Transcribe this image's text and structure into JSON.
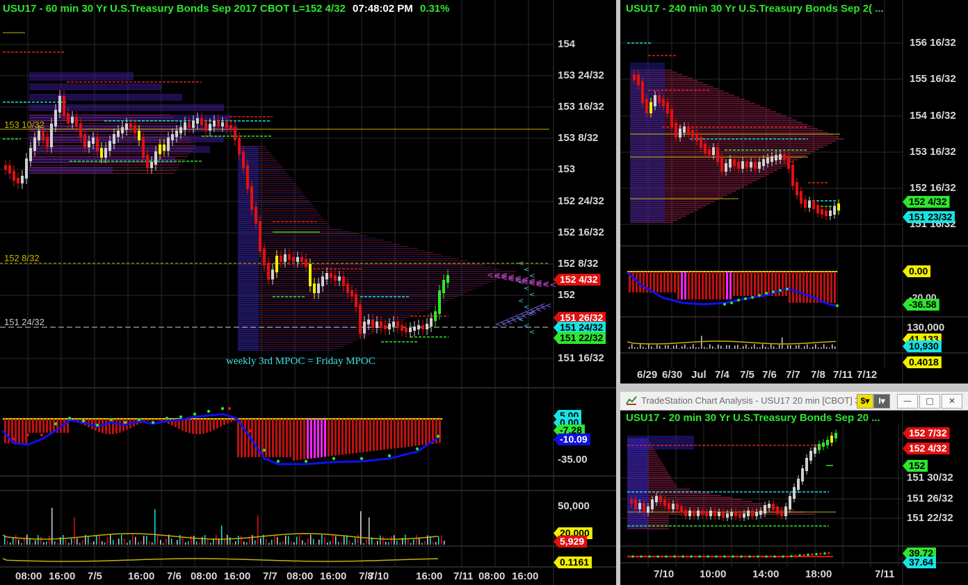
{
  "main_chart": {
    "title_parts": {
      "instrument": "USU17 - 60 min  30 Yr U.S.Treasury Bonds Sep 2017  CBOT  L=152 4/32",
      "time": "07:48:02 PM",
      "change": "0.31%"
    },
    "price_axis": [
      "154",
      "153 24/32",
      "153 16/32",
      "153 8/32",
      "153",
      "152 24/32",
      "152 16/32",
      "152 8/32",
      "152",
      "151 16/32"
    ],
    "price_tags": [
      {
        "text": "152 4/32",
        "bg": "#e01010",
        "fg": "#ffffff"
      },
      {
        "text": "151 26/32",
        "bg": "#e01010",
        "fg": "#ffffff"
      },
      {
        "text": "151 24/32",
        "bg": "#17e3e3",
        "fg": "#000000"
      },
      {
        "text": "151 22/32",
        "bg": "#2ee62e",
        "fg": "#000000"
      }
    ],
    "levels": [
      "153 10/32",
      "152 8/32",
      "151 24/32"
    ],
    "annotation": "weekly 3rd MPOC = Friday MPOC",
    "indicator_axis": [
      "-35.00"
    ],
    "indicator_tags": [
      {
        "text": "5.00",
        "bg": "#17e3e3",
        "fg": "#000000"
      },
      {
        "text": "0.00",
        "bg": "#17e3e3",
        "fg": "#000000"
      },
      {
        "text": "-7.28",
        "bg": "#2ee62e",
        "fg": "#000000"
      },
      {
        "text": "-10.09",
        "bg": "#1010e0",
        "fg": "#ffffff"
      }
    ],
    "volume_axis": [
      "50,000"
    ],
    "volume_tags": [
      {
        "text": "20,000",
        "bg": "#f0f000",
        "fg": "#000000"
      },
      {
        "text": "5,929",
        "bg": "#e01010",
        "fg": "#ffffff"
      }
    ],
    "osc_tag": {
      "text": "0.1161",
      "bg": "#f0f000",
      "fg": "#000000"
    },
    "x_axis": [
      "08:00",
      "16:00",
      "7/5",
      "16:00",
      "7/6",
      "08:00",
      "16:00",
      "7/7",
      "08:00",
      "16:00",
      "7/8",
      "7/10",
      "16:00",
      "7/11",
      "08:00",
      "16:00"
    ]
  },
  "chart_240": {
    "title": "USU17 - 240 min  30 Yr U.S.Treasury Bonds Sep 2( ...",
    "price_axis": [
      "156 16/32",
      "155 16/32",
      "154 16/32",
      "153 16/32",
      "152 16/32",
      "151 16/32"
    ],
    "price_tags": [
      {
        "text": "152 4/32",
        "bg": "#2ee62e",
        "fg": "#000000"
      },
      {
        "text": "151 23/32",
        "bg": "#17e3e3",
        "fg": "#000000"
      }
    ],
    "indicator_tags": [
      {
        "text": "0.00",
        "bg": "#f0f000",
        "fg": "#000000"
      },
      {
        "text": "-20.00",
        "bg": "#000000",
        "fg": "#d8d8d8"
      },
      {
        "text": "-36.58",
        "bg": "#2ee62e",
        "fg": "#000000"
      }
    ],
    "volume_axis": [
      "130,000"
    ],
    "volume_tags": [
      {
        "text": "41,133",
        "bg": "#f0f000",
        "fg": "#000000"
      },
      {
        "text": "10,930",
        "bg": "#17e3e3",
        "fg": "#000000"
      },
      {
        "text": "0.4018",
        "bg": "#f0f000",
        "fg": "#000000"
      }
    ],
    "x_axis": [
      "6/29",
      "6/30",
      "Jul",
      "7/4",
      "7/5",
      "7/6",
      "7/7",
      "7/8",
      "7/11",
      "7/12"
    ]
  },
  "chart_20": {
    "window_title": "TradeStation Chart Analysis - USU17 20 min [CBOT] 3...",
    "title": "USU17 - 20 min  30 Yr U.S.Treasury Bonds Sep 20 ...",
    "price_axis": [
      "151 30/32",
      "151 26/32",
      "151 22/32"
    ],
    "price_tags": [
      {
        "text": "152 7/32",
        "bg": "#e01010",
        "fg": "#ffffff"
      },
      {
        "text": "152 4/32",
        "bg": "#e01010",
        "fg": "#ffffff"
      },
      {
        "text": "152",
        "bg": "#2ee62e",
        "fg": "#000000"
      }
    ],
    "indicator_tags": [
      {
        "text": "39.72",
        "bg": "#2ee62e",
        "fg": "#000000"
      },
      {
        "text": "37.64",
        "bg": "#17e3e3",
        "fg": "#000000"
      }
    ],
    "x_axis": [
      "7/10",
      "10:00",
      "14:00",
      "18:00",
      "7/11"
    ],
    "toolbar": {
      "dollar": "$",
      "ruler": "I"
    },
    "controls": {
      "minimize": "—",
      "maximize": "□",
      "close": "✕"
    }
  },
  "colors": {
    "up": "#2ee62e",
    "down": "#e01010",
    "cyan": "#17e3e3",
    "yellow": "#f0f000",
    "magenta": "#ff22ff",
    "gold": "#c8b400"
  }
}
